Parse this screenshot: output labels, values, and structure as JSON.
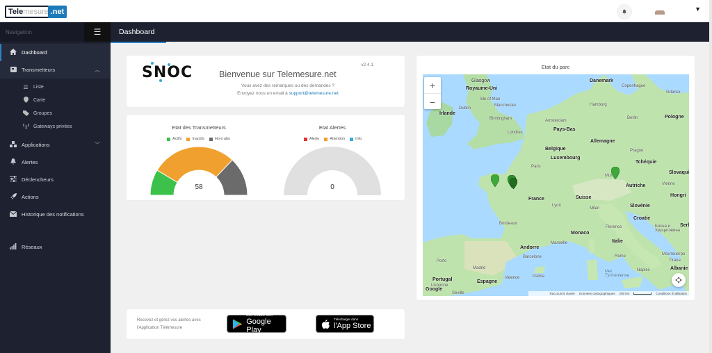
{
  "header": {
    "logo_left": "Tele",
    "logo_mid": "mesure",
    "logo_right": ".net"
  },
  "sidebar": {
    "heading": "Navigation",
    "menu_icon": "hamburger-icon",
    "items": [
      {
        "label": "Dashboard",
        "icon": "home-icon"
      },
      {
        "label": "Transmetteurs",
        "icon": "transmitter-icon"
      },
      {
        "label": "Applications",
        "icon": "applications-icon"
      },
      {
        "label": "Alertes",
        "icon": "bell-icon"
      },
      {
        "label": "Déclencheurs",
        "icon": "sliders-icon"
      },
      {
        "label": "Actions",
        "icon": "rocket-icon"
      },
      {
        "label": "Historique des notifications",
        "icon": "envelope-icon"
      },
      {
        "label": "Réseaux",
        "icon": "signal-icon"
      }
    ],
    "subitems": [
      {
        "label": "Liste",
        "icon": "list-icon"
      },
      {
        "label": "Carte",
        "icon": "map-marker-icon"
      },
      {
        "label": "Groupes",
        "icon": "tags-icon"
      },
      {
        "label": "Gateways privées",
        "icon": "antenna-icon"
      }
    ]
  },
  "page": {
    "title": "Dashboard"
  },
  "welcome": {
    "logo": "SNOC",
    "title": "Bienvenue sur Telemesure.net",
    "version": "v2.4.1",
    "line1": "Vous avez des remarques ou des demandes ?",
    "line2": "Envoyez nous un email à",
    "email": "support@telemesure.net"
  },
  "transmetteurs_chart": {
    "title": "Etat des Transmetteurs",
    "legend": [
      {
        "label": "Actifs",
        "color": "#3cc24a"
      },
      {
        "label": "Inactifs",
        "color": "#f0a02e"
      },
      {
        "label": "Hors abo",
        "color": "#6b6b6b"
      }
    ],
    "total": "58"
  },
  "alertes_chart": {
    "title": "Etat Alertes",
    "legend": [
      {
        "label": "Alerte",
        "color": "#e03535"
      },
      {
        "label": "Attention",
        "color": "#f0a02e"
      },
      {
        "label": "Info",
        "color": "#3aa8e0"
      }
    ],
    "total": "0"
  },
  "chart_data": [
    {
      "type": "pie",
      "title": "Etat des Transmetteurs",
      "categories": [
        "Actifs",
        "Inactifs",
        "Hors abo"
      ],
      "values": [
        10,
        33,
        15
      ],
      "colors": [
        "#3cc24a",
        "#f0a02e",
        "#6b6b6b"
      ]
    },
    {
      "type": "pie",
      "title": "Etat Alertes",
      "categories": [
        "Alerte",
        "Attention",
        "Info"
      ],
      "values": [
        0,
        0,
        0
      ],
      "colors": [
        "#e03535",
        "#f0a02e",
        "#3aa8e0"
      ]
    }
  ],
  "map": {
    "title": "Etat du parc",
    "zoom_in": "+",
    "zoom_out": "−",
    "labels": {
      "glasgow": "Glasgow",
      "royaume_uni": "Royaume-Uni",
      "isle_of_man": "Isle of Man",
      "manchester": "Manchester",
      "dublin": "Dublin",
      "irlande": "Irlande",
      "birmingham": "Birmingham",
      "londres": "Londres",
      "danemark": "Danemark",
      "copenhague": "Copenhague",
      "gdansk": "Gdansk",
      "hamburg": "Hamburg",
      "amsterdam": "Amsterdam",
      "pays_bas": "Pays-Bas",
      "berlin": "Berlin",
      "pologne": "Pologne",
      "allemagne": "Allemagne",
      "belgique": "Belgique",
      "luxembourg": "Luxembourg",
      "prague": "Prague",
      "tcheque": "Tchéquie",
      "paris": "Paris",
      "slovaquie": "Slovaqui",
      "munich": "Munich",
      "autriche": "Autriche",
      "vienne": "Vienne",
      "france": "France",
      "suisse": "Suisse",
      "lyon": "Lyon",
      "milan": "Milan",
      "slovenie": "Slovénie",
      "hongrie": "Hongri",
      "croatie": "Croatie",
      "bordeaux": "Bordeaux",
      "monaco": "Monaco",
      "florence": "Florence",
      "italie": "Italie",
      "bosnie": "Босна и\nХерцеговина",
      "serbie": "Serbi",
      "montenegro": "Монтенегро",
      "andorre": "Andorre",
      "marseille": "Marseille",
      "rome": "Rome",
      "barcelone": "Barcelone",
      "porto": "Porto",
      "madrid": "Madrid",
      "espagne": "Espagne",
      "portugal": "Portugal",
      "valence": "Valence",
      "lisbonne": "Lisbonne",
      "seville": "Séville",
      "naples": "Naples",
      "tirana": "Tirana",
      "albanie": "Albanie",
      "palma": "Palma",
      "mer": "Mer\nTyrrhénienne",
      "google": "Google"
    },
    "attribution": {
      "shortcuts": "Raccourcis clavier",
      "data": "Données cartographiques",
      "scale": "200 km",
      "terms": "Conditions d'utilisation"
    }
  },
  "apps": {
    "text1": "Recevez et gérez vos alertes avec",
    "text2": "l'Application Télémesure",
    "google_small": "DISPONIBLE SUR",
    "google_big": "Google Play",
    "apple_small": "Télécharger dans",
    "apple_big": "l'App Store"
  }
}
